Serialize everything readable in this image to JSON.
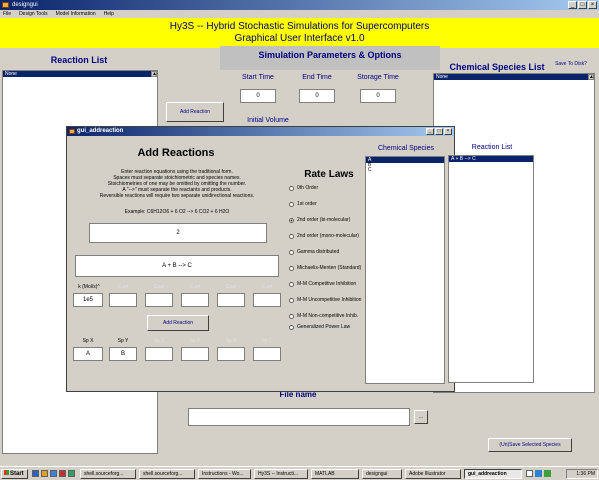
{
  "window": {
    "title": "designgui"
  },
  "menu": [
    "File",
    "Design Tools",
    "Model Information",
    "Help"
  ],
  "banner": {
    "line1": "Hy3S -- Hybrid Stochastic Simulations for Supercomputers",
    "line2": "Graphical User Interface v1.0"
  },
  "reaction_list": {
    "title": "Reaction List",
    "selected": "None"
  },
  "species_list": {
    "title": "Chemical Species List",
    "save_button": "Save To Disk?",
    "selected": "None"
  },
  "sim": {
    "title": "Simulation Parameters & Options",
    "start_time": {
      "label": "Start Time",
      "value": "0"
    },
    "end_time": {
      "label": "End Time",
      "value": "0"
    },
    "storage_time": {
      "label": "Storage Time",
      "value": "0"
    },
    "add_reaction_button": "Add Reaction",
    "initial_volume_label": "Initial Volume"
  },
  "file": {
    "label": "File name",
    "browse": "...",
    "save_button": "(Un)Save Selected Species"
  },
  "dialog": {
    "title": "gui_addreaction",
    "heading": "Add Reactions",
    "instructions": [
      "Enter reaction equations using the traditional form.",
      "Spaces must separate stoichiometric and species names.",
      "Stoichiometries of one may be omitted by omitting the number.",
      "A \"-->\" must separate the reactants and products.",
      "Reversible reactions will require two separate unidirectional reactions."
    ],
    "example": "Example: C6H12O6 + 6 O2 --> 6 CO2 + 6 H2O",
    "count_value": "2",
    "equation_value": "A + B --> C",
    "rate_label": "k (Mol/s)^",
    "rate_value": "1e5",
    "add_reaction_button": "Add Reaction",
    "coef_label": "Coef",
    "species_row_labels": [
      "Sp X",
      "Sp Y",
      "Sp Z",
      "Sp A",
      "Sp B",
      "Sp C"
    ],
    "species_values": [
      "A",
      "B",
      "",
      "",
      "",
      ""
    ],
    "rate_laws_title": "Rate Laws",
    "rate_laws": [
      "0th Order",
      "1st order",
      "2nd order (bi-molecular)",
      "2nd order (mono-molecular)",
      "Gamma distributed",
      "Michaelis-Menten (Standard)",
      "M-M Competitive Inhibition",
      "M-M Uncompetitive Inhibition",
      "M-M Non-competitive Inhib.",
      "Generalized Power Law"
    ],
    "selected_rate_law": 2,
    "chem_species_title": "Chemical Species",
    "chem_species_items": [
      "A",
      "B",
      "C"
    ],
    "reaction_list_title": "Reaction List",
    "reaction_list_items": [
      "A + B --> C"
    ]
  },
  "taskbar": {
    "start": "Start",
    "tasks": [
      "shell.sourceforg...",
      "shell.sourceforg...",
      "Instructions - Wo...",
      "Hy3S -- Instructi...",
      "MATLAB",
      "designgui",
      "Adobe Illustrator",
      "gui_addreaction"
    ],
    "active_task": 7,
    "clock": "1:36 PM"
  }
}
